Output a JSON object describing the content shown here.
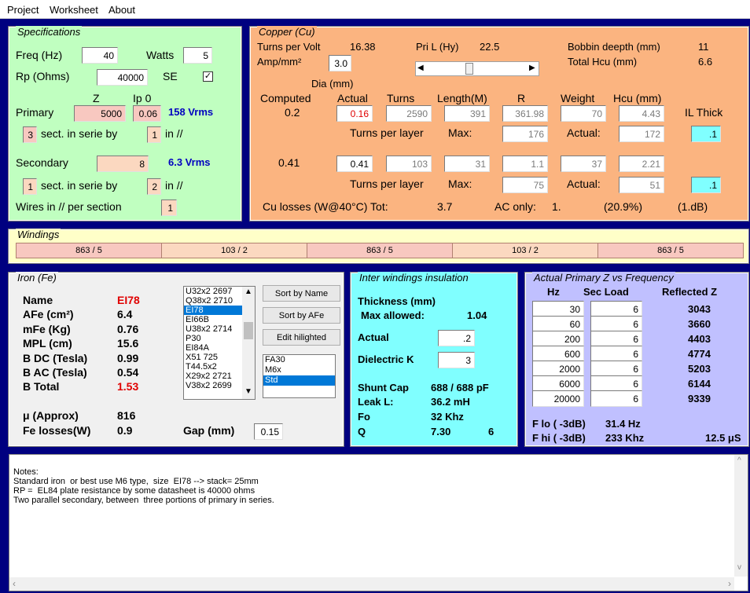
{
  "menu": [
    "Project",
    "Worksheet",
    "About"
  ],
  "spec": {
    "title": "Specifications",
    "freq_label": "Freq (Hz)",
    "freq": "40",
    "watts_label": "Watts",
    "watts": "5",
    "rp_label": "Rp (Ohms)",
    "rp": "40000",
    "se_label": "SE",
    "se_checked": "✓",
    "z_label": "Z",
    "ip0_label": "Ip 0",
    "primary_label": "Primary",
    "primary_z": "5000",
    "primary_ip0": "0.06",
    "primary_vrms": "158 Vrms",
    "p_sect": "3",
    "sect_label": "sect. in serie by",
    "p_par": "1",
    "par_label": "in //",
    "secondary_label": "Secondary",
    "secondary_z": "8",
    "secondary_vrms": "6.3 Vrms",
    "s_sect": "1",
    "s_par": "2",
    "wires_label": "Wires in // per section",
    "wires": "1"
  },
  "copper": {
    "title": "Copper (Cu)",
    "tpv_label": "Turns per Volt",
    "tpv": "16.38",
    "pril_label": "Pri L (Hy)",
    "pril": "22.5",
    "bobbin_label": "Bobbin deepth (mm)",
    "bobbin": "11",
    "amp_label": "Amp/mm²",
    "amp": "3.0",
    "hcu_total_label": "Total Hcu (mm)",
    "hcu_total": "6.6",
    "dia_label": "Dia (mm)",
    "headers": {
      "computed": "Computed",
      "actual": "Actual",
      "turns": "Turns",
      "length": "Length(M)",
      "r": "R",
      "weight": "Weight",
      "hcu": "Hcu (mm)",
      "il": "IL Thick"
    },
    "pri": {
      "computed": "0.2",
      "actual": "0.16",
      "turns": "2590",
      "length": "391",
      "r": "361.98",
      "weight": "70",
      "hcu": "4.43",
      "il": ".1",
      "max": "176",
      "act": "172"
    },
    "sec": {
      "computed": "0.41",
      "actual": "0.41",
      "turns": "103",
      "length": "31",
      "r": "1.1",
      "weight": "37",
      "hcu": "2.21",
      "il": ".1",
      "max": "75",
      "act": "51"
    },
    "tpl_label": "Turns per layer",
    "max_label": "Max:",
    "actual_label": "Actual:",
    "losses_label": "Cu losses (W@40°C) Tot:",
    "losses_tot": "3.7",
    "ac_label": "AC only:",
    "ac_val": "1.",
    "ac_pct": "(20.9%)",
    "ac_db": "(1.dB)"
  },
  "windings": {
    "title": "Windings",
    "segments": [
      "863 / 5",
      "103 / 2",
      "863 / 5",
      "103 / 2",
      "863 / 5"
    ]
  },
  "iron": {
    "title": "Iron (Fe)",
    "rows": [
      {
        "label": "Name",
        "value": "EI78"
      },
      {
        "label": "AFe (cm²)",
        "value": "6.4"
      },
      {
        "label": "mFe (Kg)",
        "value": "0.76"
      },
      {
        "label": "MPL (cm)",
        "value": "15.6"
      },
      {
        "label": "B DC (Tesla)",
        "value": "0.99"
      },
      {
        "label": "B AC (Tesla)",
        "value": "0.54"
      },
      {
        "label": "B Total",
        "value": "1.53"
      }
    ],
    "mu_label": "μ (Approx)",
    "mu": "816",
    "fe_label": "Fe losses(W)",
    "fe": "0.9",
    "gap_label": "Gap (mm)",
    "gap": "0.15",
    "cores": [
      "U32x2  2697",
      "Q38x2  2710",
      "EI78",
      "EI66B",
      "U38x2  2714",
      "P30",
      "EI84A",
      "X51  725",
      "T44.5x2",
      "X29x2  2721",
      "V38x2  2699"
    ],
    "selected_core": "EI78",
    "sort_name": "Sort by Name",
    "sort_afe": "Sort by AFe",
    "edit": "Edit hilighted",
    "materials": [
      "FA30",
      "M6x",
      "Std"
    ],
    "selected_material": "Std"
  },
  "insul": {
    "title": "Inter windings insulation",
    "thick_label": "Thickness (mm)",
    "max_label": "Max allowed:",
    "max": "1.04",
    "actual_label": "Actual",
    "actual": ".2",
    "dk_label": "Dielectric K",
    "dk": "3",
    "shunt_label": "Shunt Cap",
    "shunt": "688 / 688 pF",
    "leak_label": "Leak L:",
    "leak": "36.2 mH",
    "fo_label": "Fo",
    "fo": "32 Khz",
    "q_label": "Q",
    "q": "7.30",
    "q2": "6"
  },
  "zfreq": {
    "title": "Actual Primary Z vs Frequency",
    "hz_label": "Hz",
    "sec_label": "Sec Load",
    "refl_label": "Reflected Z",
    "rows": [
      {
        "hz": "30",
        "load": "6",
        "z": "3043"
      },
      {
        "hz": "60",
        "load": "6",
        "z": "3660"
      },
      {
        "hz": "200",
        "load": "6",
        "z": "4403"
      },
      {
        "hz": "600",
        "load": "6",
        "z": "4774"
      },
      {
        "hz": "2000",
        "load": "6",
        "z": "5203"
      },
      {
        "hz": "6000",
        "load": "6",
        "z": "6144"
      },
      {
        "hz": "20000",
        "load": "6",
        "z": "9339"
      }
    ],
    "flo_label": "F lo ( -3dB)",
    "flo": "31.4 Hz",
    "fhi_label": "F hi ( -3dB)",
    "fhi": "233 Khz",
    "rise": "12.5 μS"
  },
  "notes": "Notes:\nStandard iron  or best use M6 type,  size  EI78 --> stack= 25mm\nRP =  EL84 plate resistance by some datasheet is 40000 ohms\nTwo parallel secondary, between  three portions of primary in series.",
  "colors": {
    "spec": "#c0ffc0",
    "copper": "#fbb480",
    "windings": "#ffffc8",
    "iron": "#f0f0f0",
    "insul": "#80ffff",
    "zfreq": "#c0c0ff"
  }
}
